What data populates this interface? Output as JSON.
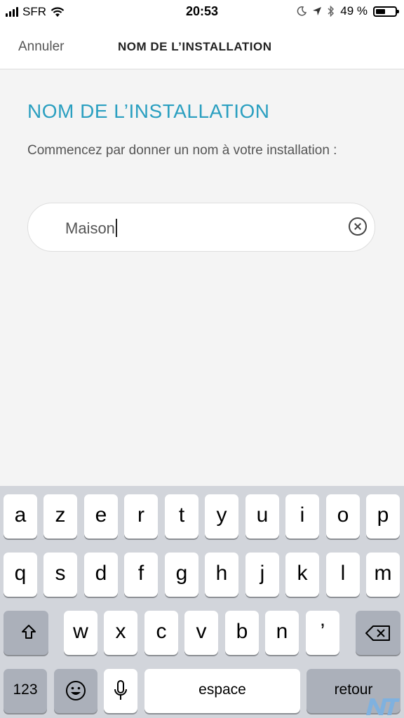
{
  "status_bar": {
    "carrier": "SFR",
    "time": "20:53",
    "battery_percent": "49 %",
    "battery_level": 0.49,
    "icons": [
      "signal-icon",
      "wifi-icon",
      "moon-icon",
      "location-icon",
      "bluetooth-icon",
      "battery-icon"
    ]
  },
  "nav": {
    "cancel_label": "Annuler",
    "title": "NOM DE L’INSTALLATION"
  },
  "form": {
    "heading": "NOM DE L’INSTALLATION",
    "description": "Commencez par donner un nom à votre installation :",
    "input_value": "Maison"
  },
  "keyboard": {
    "row1": [
      "a",
      "z",
      "e",
      "r",
      "t",
      "y",
      "u",
      "i",
      "o",
      "p"
    ],
    "row2": [
      "q",
      "s",
      "d",
      "f",
      "g",
      "h",
      "j",
      "k",
      "l",
      "m"
    ],
    "row3": [
      "w",
      "x",
      "c",
      "v",
      "b",
      "n",
      "’"
    ],
    "numbers_label": "123",
    "space_label": "espace",
    "return_label": "retour"
  },
  "colors": {
    "accent": "#2a9fc0",
    "keyboard_bg": "#d2d5db",
    "dark_key": "#abb0ba"
  }
}
